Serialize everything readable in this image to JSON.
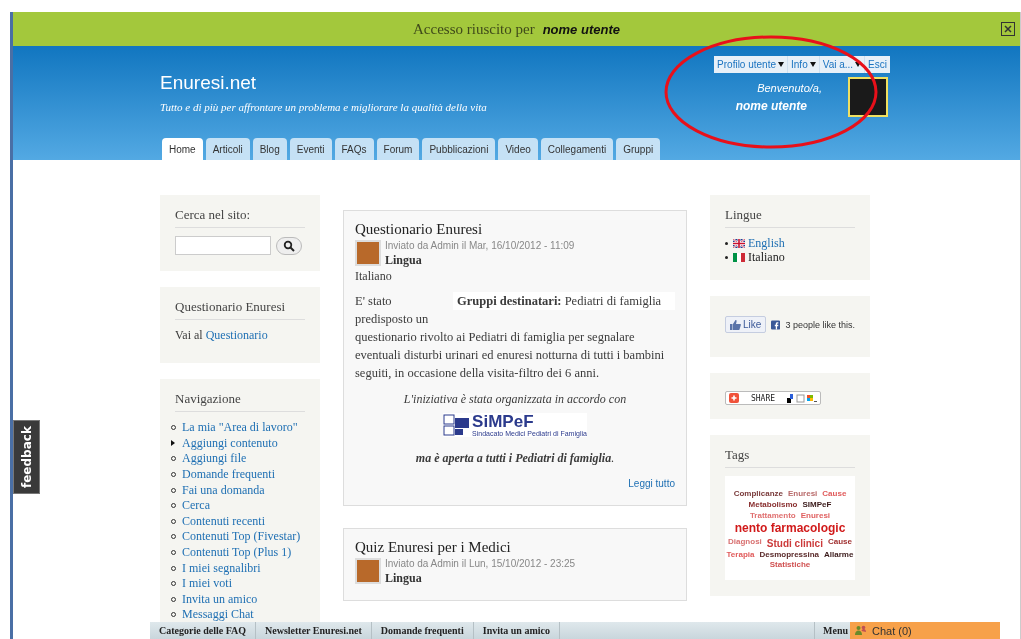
{
  "notice": {
    "text": "Accesso riuscito per",
    "user": "nome utente"
  },
  "header": {
    "site_name": "Enuresi.net",
    "slogan": "Tutto e di più per affrontare un problema e migliorare la qualità della vita"
  },
  "user_menu": [
    {
      "label": "Profilo utente",
      "dropdown": true
    },
    {
      "label": "Info",
      "dropdown": true
    },
    {
      "label": "Vai a...",
      "dropdown": true
    },
    {
      "label": "Esci",
      "dropdown": false
    }
  ],
  "welcome": {
    "greeting": "Benvenuto/a,",
    "user": "nome utente"
  },
  "tabs": [
    {
      "label": "Home",
      "selected": true
    },
    {
      "label": "Articoli",
      "selected": false
    },
    {
      "label": "Blog",
      "selected": false
    },
    {
      "label": "Eventi",
      "selected": false
    },
    {
      "label": "FAQs",
      "selected": false
    },
    {
      "label": "Forum",
      "selected": false
    },
    {
      "label": "Pubblicazioni",
      "selected": false
    },
    {
      "label": "Video",
      "selected": false
    },
    {
      "label": "Collegamenti",
      "selected": false
    },
    {
      "label": "Gruppi",
      "selected": false
    }
  ],
  "search_block": {
    "title": "Cerca nel sito:"
  },
  "questionnaire_block": {
    "title": "Questionario Enuresi",
    "text": "Vai al",
    "link": "Questionario"
  },
  "navigation": {
    "title": "Navigazione",
    "items": [
      {
        "label": "La mia \"Area di lavoro\"",
        "kind": "link"
      },
      {
        "label": "Aggiungi contenuto",
        "kind": "expandable"
      },
      {
        "label": "Aggiungi file",
        "kind": "link"
      },
      {
        "label": "Domande frequenti",
        "kind": "link"
      },
      {
        "label": "Fai una domanda",
        "kind": "link"
      },
      {
        "label": "Cerca",
        "kind": "link"
      },
      {
        "label": "Contenuti recenti",
        "kind": "link"
      },
      {
        "label": "Contenuti Top (Fivestar)",
        "kind": "link"
      },
      {
        "label": "Contenuti Top (Plus 1)",
        "kind": "link"
      },
      {
        "label": "I miei segnalibri",
        "kind": "link"
      },
      {
        "label": "I miei voti",
        "kind": "link"
      },
      {
        "label": "Invita un amico",
        "kind": "link"
      },
      {
        "label": "Messaggi Chat",
        "kind": "link"
      }
    ]
  },
  "articles": [
    {
      "title": "Questionario Enuresi",
      "meta": "Inviato da Admin il Mar, 16/10/2012 - 11:09",
      "field_label": "Lingua",
      "field_value": "Italiano",
      "groups_label": "Gruppi destinatari:",
      "groups_value": "Pediatri di famiglia",
      "body_lead": "E' stato predisposto un",
      "body": "questionario rivolto ai Pediatri di famiglia per segnalare eventuali disturbi urinari ed enuresi notturna di tutti i bambini seguiti, in occasione della visita-filtro dei 6 anni.",
      "note": "L'iniziativa è stata organizzata in accordo con",
      "logo": {
        "name": "SiMPeF",
        "subtitle": "Sindacato Medici Pediatri di Famiglia"
      },
      "closing": "**ma è aperta a tutti i Pediatri di famiglia**.",
      "read_more": "Leggi tutto"
    },
    {
      "title": "Quiz Enuresi per i Medici",
      "meta": "Inviato da Admin il Lun, 15/10/2012 - 23:25",
      "field_label": "Lingua"
    }
  ],
  "languages": {
    "title": "Lingue",
    "items": [
      {
        "label": "English",
        "kind": "uk",
        "selected": false
      },
      {
        "label": "Italiano",
        "kind": "it",
        "selected": true
      }
    ]
  },
  "like": {
    "button": "Like",
    "text": "3 people like this."
  },
  "share": {
    "button": "SHARE"
  },
  "tags": {
    "title": "Tags",
    "words": [
      {
        "text": "Complicanze",
        "kind": "small",
        "color": "#7a3b3b"
      },
      {
        "text": "Enuresi",
        "kind": "small",
        "color": "#b86a6a"
      },
      {
        "text": "Cause",
        "kind": "small",
        "color": "#e05a5a"
      },
      {
        "text": "Metabolismo",
        "kind": "small",
        "color": "#8a3030"
      },
      {
        "text": "SIMPeF",
        "kind": "small",
        "color": "#3a1a1a"
      },
      {
        "text": "Trattamento",
        "kind": "small",
        "color": "#e07070"
      },
      {
        "text": "Enuresi",
        "kind": "small",
        "color": "#e06060"
      },
      {
        "text": "nento farmacologic",
        "kind": "huge",
        "color": "#d11a1a"
      },
      {
        "text": "Diagnosi",
        "kind": "small",
        "color": "#d87070"
      },
      {
        "text": "Studi clinici",
        "kind": "medium",
        "color": "#cc3a3a"
      },
      {
        "text": "Cause",
        "kind": "small",
        "color": "#a03030"
      },
      {
        "text": "Terapia",
        "kind": "small",
        "color": "#e05a5a"
      },
      {
        "text": "Desmopressina",
        "kind": "small",
        "color": "#5a2a2a"
      },
      {
        "text": "Allarme",
        "kind": "small",
        "color": "#3a1a1a"
      },
      {
        "text": "Statistiche",
        "kind": "small",
        "color": "#d05050"
      }
    ]
  },
  "footer_bar": {
    "links": [
      "Categorie delle FAQ",
      "Newsletter Enuresi.net",
      "Domande frequenti",
      "Invita un amico"
    ],
    "menu": "Menu",
    "chat": "Chat (0)"
  },
  "feedback_tab": "feedback"
}
